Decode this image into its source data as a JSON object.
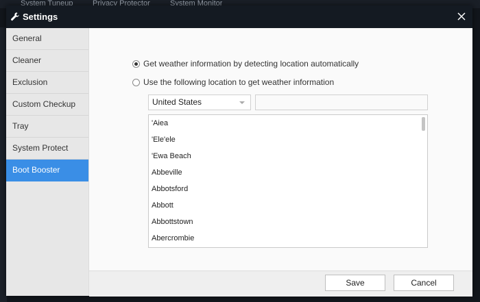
{
  "background": {
    "tabs": [
      "System Tuneup",
      "Privacy Protector",
      "System Monitor"
    ]
  },
  "dialog": {
    "title": "Settings",
    "sidebar": {
      "items": [
        {
          "label": "General",
          "active": false
        },
        {
          "label": "Cleaner",
          "active": false
        },
        {
          "label": "Exclusion",
          "active": false
        },
        {
          "label": "Custom Checkup",
          "active": false
        },
        {
          "label": "Tray",
          "active": false
        },
        {
          "label": "System Protect",
          "active": false
        },
        {
          "label": "Boot Booster",
          "active": true
        }
      ]
    },
    "weather": {
      "auto_label": "Get weather information by detecting location automatically",
      "manual_label": "Use the following location to get weather information",
      "auto_selected": true,
      "country": "United States",
      "filter_value": "",
      "cities": [
        "'Aiea",
        "'Ele'ele",
        "'Ewa Beach",
        "Abbeville",
        "Abbotsford",
        "Abbott",
        "Abbottstown",
        "Abercrombie"
      ]
    },
    "footer": {
      "save_label": "Save",
      "cancel_label": "Cancel"
    }
  },
  "colors": {
    "accent": "#3a8ee6",
    "titlebar": "#141a22"
  }
}
